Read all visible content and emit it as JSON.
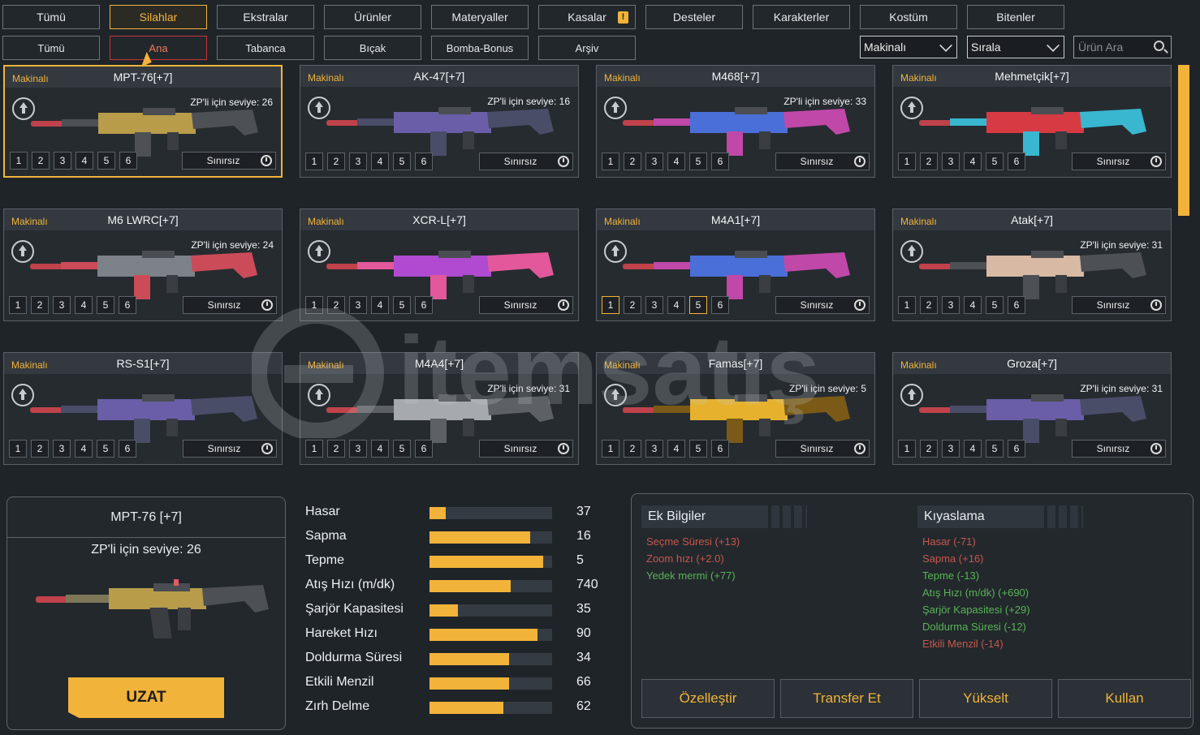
{
  "tabs_main": [
    {
      "label": "Tümü"
    },
    {
      "label": "Silahlar"
    },
    {
      "label": "Ekstralar"
    },
    {
      "label": "Ürünler"
    },
    {
      "label": "Materyaller"
    },
    {
      "label": "Kasalar"
    },
    {
      "label": "Desteler"
    },
    {
      "label": "Karakterler"
    },
    {
      "label": "Kostüm"
    },
    {
      "label": "Bitenler"
    }
  ],
  "tabs_main_selected": "Silahlar",
  "kasalar_badge": "!",
  "tabs_sub": [
    {
      "label": "Tümü"
    },
    {
      "label": "Ana"
    },
    {
      "label": "Tabanca"
    },
    {
      "label": "Bıçak"
    },
    {
      "label": "Bomba-Bonus"
    },
    {
      "label": "Arşiv"
    }
  ],
  "tabs_sub_selected": "Ana",
  "filters": {
    "category": "Makinalı",
    "sort": "Sırala",
    "search_placeholder": "Ürün Ara"
  },
  "colors": {
    "accent": "#f2b33a",
    "bg": "#1f2429",
    "negative": "#c6584b",
    "positive": "#58b455"
  },
  "items": [
    {
      "category": "Makinalı",
      "name": "MPT-76[+7]",
      "level": "ZP'li için seviye: 26",
      "duration": "Sınırsız",
      "slots": [
        "1",
        "2",
        "3",
        "4",
        "5",
        "6"
      ],
      "active_slots": [],
      "selected": true,
      "skin": "gold"
    },
    {
      "category": "Makinalı",
      "name": "AK-47[+7]",
      "level": "ZP'li için seviye: 16",
      "duration": "Sınırsız",
      "slots": [
        "1",
        "2",
        "3",
        "4",
        "5",
        "6"
      ],
      "active_slots": [],
      "selected": false,
      "skin": "violet"
    },
    {
      "category": "Makinalı",
      "name": "M468[+7]",
      "level": "ZP'li için seviye: 33",
      "duration": "Sınırsız",
      "slots": [
        "1",
        "2",
        "3",
        "4",
        "5",
        "6"
      ],
      "active_slots": [],
      "selected": false,
      "skin": "cosmic"
    },
    {
      "category": "Makinalı",
      "name": "Mehmetçik[+7]",
      "level": "",
      "duration": "Sınırsız",
      "slots": [
        "1",
        "2",
        "3",
        "4",
        "5",
        "6"
      ],
      "active_slots": [],
      "selected": false,
      "skin": "redcyan"
    },
    {
      "category": "Makinalı",
      "name": "M6 LWRC[+7]",
      "level": "ZP'li için seviye: 24",
      "duration": "Sınırsız",
      "slots": [
        "1",
        "2",
        "3",
        "4",
        "5",
        "6"
      ],
      "active_slots": [],
      "selected": false,
      "skin": "grey"
    },
    {
      "category": "Makinalı",
      "name": "XCR-L[+7]",
      "level": "",
      "duration": "Sınırsız",
      "slots": [
        "1",
        "2",
        "3",
        "4",
        "5",
        "6"
      ],
      "active_slots": [],
      "selected": false,
      "skin": "pink"
    },
    {
      "category": "Makinalı",
      "name": "M4A1[+7]",
      "level": "",
      "duration": "Sınırsız",
      "slots": [
        "1",
        "2",
        "3",
        "4",
        "5",
        "6"
      ],
      "active_slots": [
        "1",
        "5"
      ],
      "selected": false,
      "skin": "cosmic"
    },
    {
      "category": "Makinalı",
      "name": "Atak[+7]",
      "level": "ZP'li için seviye: 31",
      "duration": "Sınırsız",
      "slots": [
        "1",
        "2",
        "3",
        "4",
        "5",
        "6"
      ],
      "active_slots": [],
      "selected": false,
      "skin": "tan"
    },
    {
      "category": "Makinalı",
      "name": "RS-S1[+7]",
      "level": "",
      "duration": "Sınırsız",
      "slots": [
        "1",
        "2",
        "3",
        "4",
        "5",
        "6"
      ],
      "active_slots": [],
      "selected": false,
      "skin": "violet"
    },
    {
      "category": "Makinalı",
      "name": "M4A4[+7]",
      "level": "ZP'li için seviye: 31",
      "duration": "Sınırsız",
      "slots": [
        "1",
        "2",
        "3",
        "4",
        "5",
        "6"
      ],
      "active_slots": [],
      "selected": false,
      "skin": "silver"
    },
    {
      "category": "Makinalı",
      "name": "Famas[+7]",
      "level": "ZP'li için seviye: 5",
      "duration": "Sınırsız",
      "slots": [
        "1",
        "2",
        "3",
        "4",
        "5",
        "6"
      ],
      "active_slots": [],
      "selected": false,
      "skin": "goldbright"
    },
    {
      "category": "Makinalı",
      "name": "Groza[+7]",
      "level": "ZP'li için seviye: 31",
      "duration": "Sınırsız",
      "slots": [
        "1",
        "2",
        "3",
        "4",
        "5",
        "6"
      ],
      "active_slots": [],
      "selected": false,
      "skin": "violet"
    }
  ],
  "selected_item": {
    "name": "MPT-76 [+7]",
    "level": "ZP'li için seviye: 26",
    "button": "UZAT"
  },
  "stats": [
    {
      "label": "Hasar",
      "value": "37",
      "fill": 0.13
    },
    {
      "label": "Sapma",
      "value": "16",
      "fill": 0.82
    },
    {
      "label": "Tepme",
      "value": "5",
      "fill": 0.93
    },
    {
      "label": "Atış Hızı (m/dk)",
      "value": "740",
      "fill": 0.66
    },
    {
      "label": "Şarjör Kapasitesi",
      "value": "35",
      "fill": 0.23
    },
    {
      "label": "Hareket Hızı",
      "value": "90",
      "fill": 0.88
    },
    {
      "label": "Doldurma Süresi",
      "value": "34",
      "fill": 0.65
    },
    {
      "label": "Etkili Menzil",
      "value": "66",
      "fill": 0.65
    },
    {
      "label": "Zırh Delme",
      "value": "62",
      "fill": 0.6
    }
  ],
  "extra_info": {
    "title": "Ek Bilgiler",
    "lines": [
      {
        "text": "Seçme Süresi (+13)",
        "tone": "neg"
      },
      {
        "text": "Zoom hızı (+2.0)",
        "tone": "neg"
      },
      {
        "text": "Yedek mermi (+77)",
        "tone": "pos"
      }
    ]
  },
  "comparison": {
    "title": "Kıyaslama",
    "lines": [
      {
        "text": "Hasar (-71)",
        "tone": "neg"
      },
      {
        "text": "Sapma (+16)",
        "tone": "neg"
      },
      {
        "text": "Tepme (-13)",
        "tone": "pos"
      },
      {
        "text": "Atış Hızı (m/dk) (+690)",
        "tone": "pos"
      },
      {
        "text": "Şarjör Kapasitesi (+29)",
        "tone": "pos"
      },
      {
        "text": "Doldurma Süresi (-12)",
        "tone": "pos"
      },
      {
        "text": "Etkili Menzil (-14)",
        "tone": "neg"
      }
    ]
  },
  "actions": [
    {
      "label": "Özelleştir"
    },
    {
      "label": "Transfer Et"
    },
    {
      "label": "Yükselt"
    },
    {
      "label": "Kullan"
    }
  ],
  "watermark": "itemsatış"
}
